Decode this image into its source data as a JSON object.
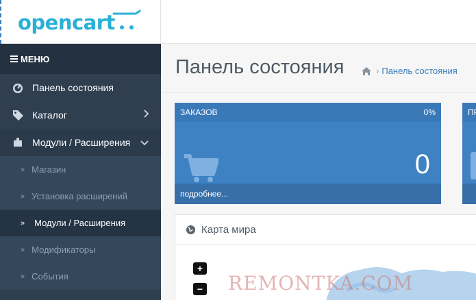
{
  "header": {
    "logo_text": "opencart"
  },
  "sidebar": {
    "menu_label": "МЕНЮ",
    "items": [
      {
        "label": "Панель состояния",
        "icon": "dashboard-icon"
      },
      {
        "label": "Каталог",
        "icon": "tags-icon"
      },
      {
        "label": "Модули / Расширения",
        "icon": "puzzle-icon"
      }
    ],
    "sub_items": [
      {
        "label": "Магазин"
      },
      {
        "label": "Установка расширений"
      },
      {
        "label": "Модули / Расширения"
      },
      {
        "label": "Модификаторы"
      },
      {
        "label": "События"
      }
    ]
  },
  "main": {
    "title": "Панель состояния",
    "breadcrumb": {
      "home_icon": "home-icon",
      "current": "Панель состояния"
    },
    "tile": {
      "title": "ЗАКАЗОВ",
      "percent": "0%",
      "value": "0",
      "more": "подробнее...",
      "icon": "cart-icon"
    },
    "tile2": {
      "title": "ПР"
    },
    "map_panel": {
      "title": "Карта мира",
      "zoom_in": "+",
      "zoom_out": "−"
    }
  },
  "watermark": "REMONTKA.COM",
  "colors": {
    "sidebar": "#2f3f50",
    "tile": "#3f82c4",
    "link": "#3a7dbd",
    "logo": "#2ab0d8"
  }
}
